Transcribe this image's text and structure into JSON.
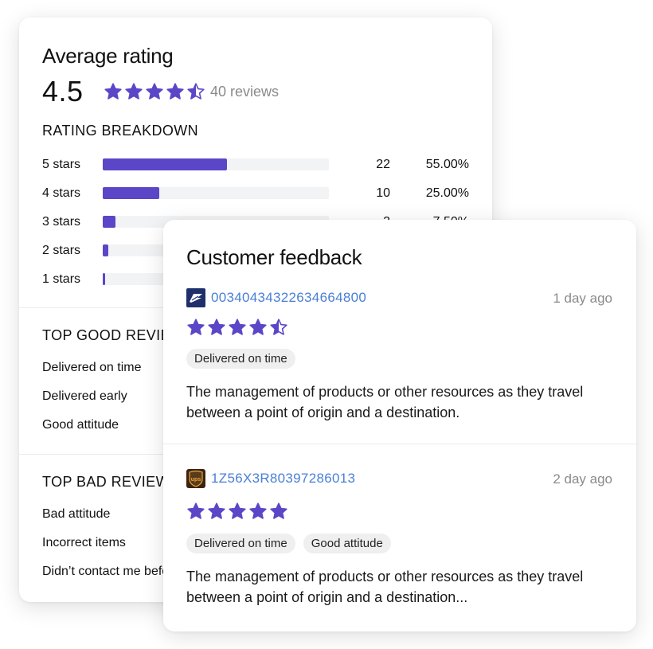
{
  "colors": {
    "accent": "#5b46c8",
    "link": "#4a7fd6",
    "muted": "#8a8a8a"
  },
  "rating": {
    "title": "Average rating",
    "score": "4.5",
    "stars": 4.5,
    "review_count": "40 reviews",
    "breakdown_title": "RATING BREAKDOWN",
    "breakdown": [
      {
        "label": "5 stars",
        "count": "22",
        "percent": "55.00%",
        "fraction": 0.55
      },
      {
        "label": "4 stars",
        "count": "10",
        "percent": "25.00%",
        "fraction": 0.25
      },
      {
        "label": "3 stars",
        "count": "3",
        "percent": "7.50%",
        "fraction": 0.055
      },
      {
        "label": "2 stars",
        "count": "",
        "percent": "",
        "fraction": 0.025
      },
      {
        "label": "1 stars",
        "count": "",
        "percent": "",
        "fraction": 0.012
      }
    ],
    "good_title": "TOP GOOD REVIEWS",
    "good_items": [
      "Delivered on time",
      "Delivered early",
      "Good attitude"
    ],
    "bad_title": "TOP BAD REVIEWS",
    "bad_items": [
      "Bad attitude",
      "Incorrect items",
      "Didn’t contact me before delivering"
    ]
  },
  "feedback": {
    "title": "Customer feedback",
    "items": [
      {
        "carrier_icon": "usps-icon",
        "tracking": "00340434322634664800",
        "time": "1 day ago",
        "stars": 4.5,
        "tags": [
          "Delivered on time"
        ],
        "text": "The management of products or other resources as they travel between a point of origin and a destination."
      },
      {
        "carrier_icon": "ups-icon",
        "tracking": "1Z56X3R80397286013",
        "time": "2 day ago",
        "stars": 5,
        "tags": [
          "Delivered on time",
          "Good attitude"
        ],
        "text": "The management of products or other resources as they travel between a point of origin and a destination..."
      }
    ]
  }
}
